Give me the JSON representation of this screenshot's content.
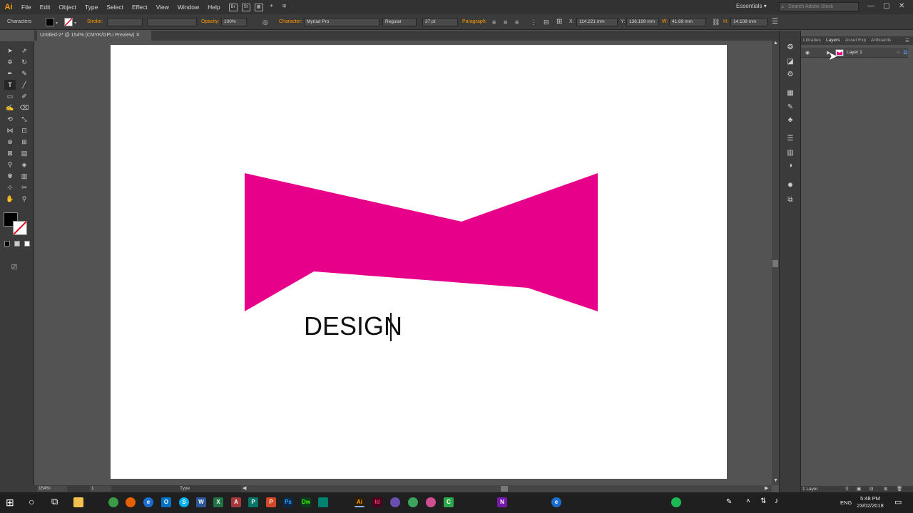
{
  "app": {
    "logo": "Ai",
    "menus": [
      "File",
      "Edit",
      "Object",
      "Type",
      "Select",
      "Effect",
      "View",
      "Window",
      "Help"
    ],
    "bridge_labels": [
      "Br",
      "St"
    ],
    "workspace": "Essentials",
    "stock_placeholder": "Search Adobe Stock"
  },
  "control_bar": {
    "mode_label": "Characters",
    "stroke_label": "Stroke:",
    "opacity_label": "Opacity:",
    "opacity_value": "100%",
    "character_label": "Character:",
    "font_name": "Myriad Pro",
    "font_style": "Regular",
    "font_size": "37 pt",
    "paragraph_label": "Paragraph:",
    "x_label": "X:",
    "x_value": "114.221 mm",
    "y_label": "Y:",
    "y_value": "136.199 mm",
    "w_label": "W:",
    "w_value": "41.69 mm",
    "h_label": "H:",
    "h_value": "14.108 mm"
  },
  "document": {
    "tab_title": "Untitled-2* @ 154% (CMYK/GPU Preview)"
  },
  "canvas": {
    "text": "DESIGN",
    "shape_color": "#e6008a"
  },
  "status_bar": {
    "zoom": "154%",
    "artboard": "1",
    "tool": "Type"
  },
  "layers_panel": {
    "tabs": [
      "Libraries",
      "Layers",
      "Asset Exp",
      "Artboards"
    ],
    "layer_name": "Layer 1",
    "footer": "1 Layer"
  },
  "taskbar": {
    "language": "ENG",
    "time": "5:48 PM",
    "date": "23/02/2018"
  }
}
